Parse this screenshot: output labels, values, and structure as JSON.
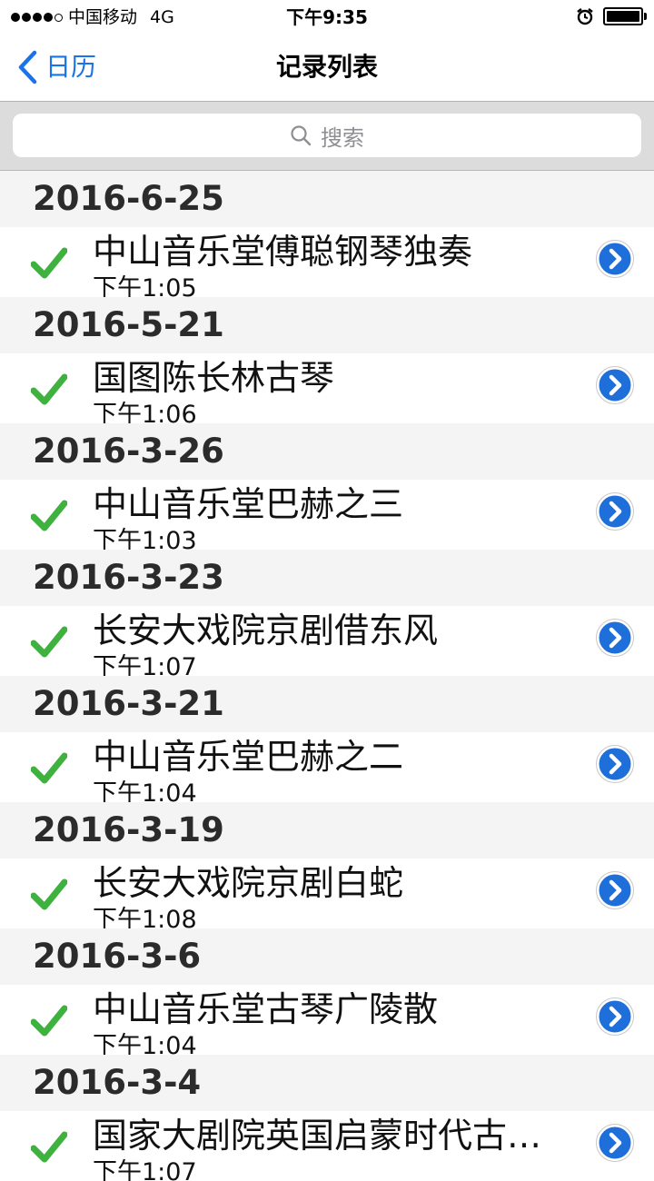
{
  "status_bar": {
    "carrier": "中国移动",
    "network": "4G",
    "time": "下午9:35",
    "signal_bars_filled": 4,
    "signal_bars_total": 5
  },
  "nav": {
    "back_label": "日历",
    "title": "记录列表"
  },
  "search": {
    "placeholder": "搜索"
  },
  "colors": {
    "accent": "#1a73e8",
    "check": "#3fb13f",
    "disclosure": "#1e6fd9"
  },
  "sections": [
    {
      "date": "2016-6-25",
      "item": {
        "title": "中山音乐堂傅聪钢琴独奏",
        "time": "下午1:05"
      }
    },
    {
      "date": "2016-5-21",
      "item": {
        "title": "国图陈长林古琴",
        "time": "下午1:06"
      }
    },
    {
      "date": "2016-3-26",
      "item": {
        "title": "中山音乐堂巴赫之三",
        "time": "下午1:03"
      }
    },
    {
      "date": "2016-3-23",
      "item": {
        "title": "长安大戏院京剧借东风",
        "time": "下午1:07"
      }
    },
    {
      "date": "2016-3-21",
      "item": {
        "title": "中山音乐堂巴赫之二",
        "time": "下午1:04"
      }
    },
    {
      "date": "2016-3-19",
      "item": {
        "title": "长安大戏院京剧白蛇",
        "time": "下午1:08"
      }
    },
    {
      "date": "2016-3-6",
      "item": {
        "title": "中山音乐堂古琴广陵散",
        "time": "下午1:04"
      }
    },
    {
      "date": "2016-3-4",
      "item": {
        "title": "国家大剧院英国启蒙时代古…",
        "time": "下午1:07"
      }
    }
  ]
}
